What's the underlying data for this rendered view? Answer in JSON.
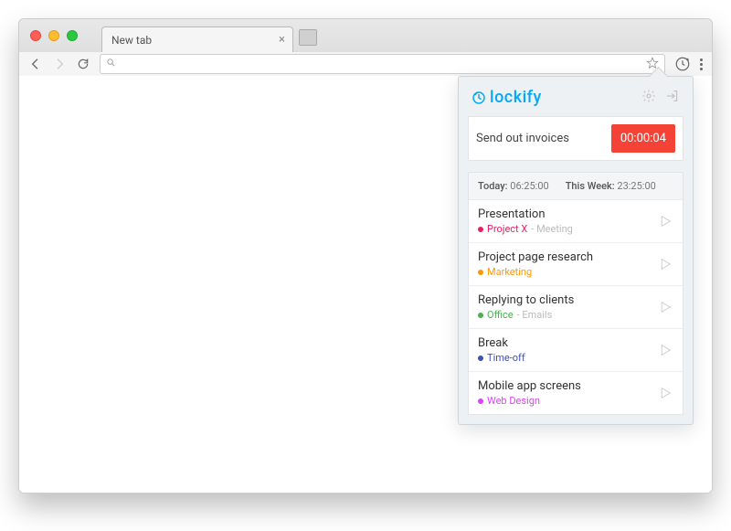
{
  "browser": {
    "tab_title": "New tab",
    "omnibox_value": "",
    "omnibox_placeholder": ""
  },
  "popup": {
    "brand": "lockify",
    "timer": {
      "description": "Send out invoices",
      "elapsed": "00:00:04"
    },
    "summary": {
      "today_label": "Today:",
      "today_value": "06:25:00",
      "week_label": "This Week:",
      "week_value": "23:25:00"
    },
    "entries": [
      {
        "title": "Presentation",
        "project": "Project X",
        "project_color": "#e91e63",
        "tag": "Meeting"
      },
      {
        "title": "Project page research",
        "project": "Marketing",
        "project_color": "#ff9800",
        "tag": ""
      },
      {
        "title": "Replying to clients",
        "project": "Office",
        "project_color": "#4caf50",
        "tag": "Emails"
      },
      {
        "title": "Break",
        "project": "Time-off",
        "project_color": "#3f51b5",
        "tag": ""
      },
      {
        "title": "Mobile app screens",
        "project": "Web Design",
        "project_color": "#e040fb",
        "tag": ""
      }
    ]
  },
  "colors": {
    "accent": "#03a9f4",
    "danger": "#f44336"
  }
}
